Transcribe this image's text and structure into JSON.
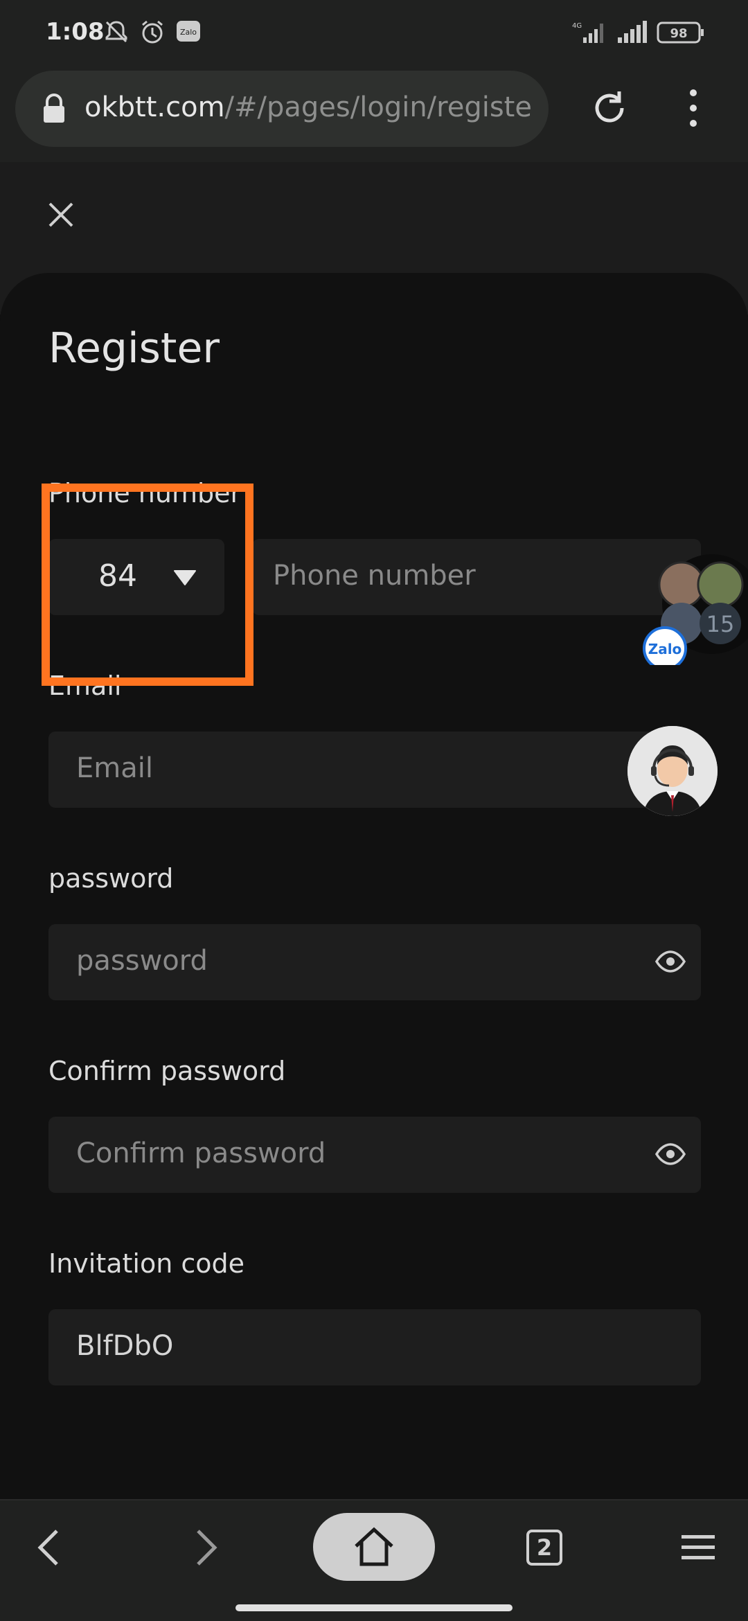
{
  "status_bar": {
    "time": "1:08",
    "network": "4G",
    "battery": "98"
  },
  "browser": {
    "url_host": "okbtt.com",
    "url_path": "/#/pages/login/registe",
    "tab_count": "2"
  },
  "form": {
    "title": "Register",
    "phone": {
      "label": "Phone number",
      "country_code": "84",
      "placeholder": "Phone number"
    },
    "email": {
      "label": "Email",
      "placeholder": "Email"
    },
    "password": {
      "label": "password",
      "placeholder": "password"
    },
    "confirm_password": {
      "label": "Confirm password",
      "placeholder": "Confirm password"
    },
    "invitation_code": {
      "label": "Invitation code",
      "value": "BlfDbO"
    }
  },
  "zalo_bubble": {
    "brand": "Zalo",
    "count": "15"
  },
  "colors": {
    "highlight": "#ff7420",
    "background": "#111111",
    "field": "#1e1e1e"
  }
}
